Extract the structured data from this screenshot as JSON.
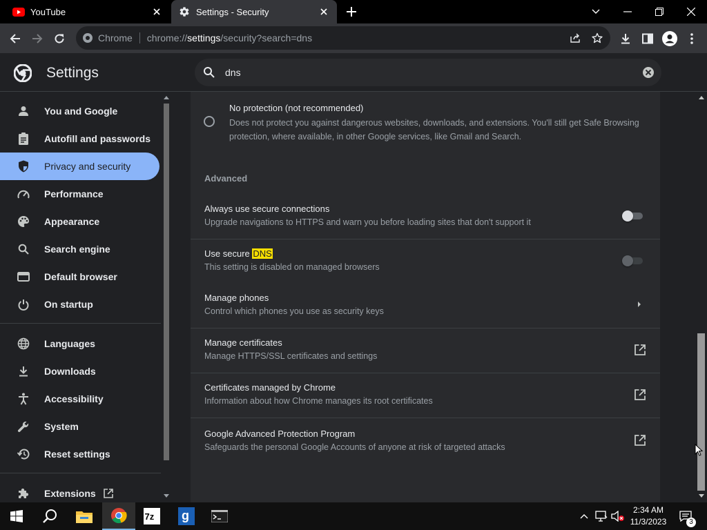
{
  "browser": {
    "tabs": [
      {
        "title": "YouTube",
        "favicon": "youtube-icon",
        "active": false
      },
      {
        "title": "Settings - Security",
        "favicon": "gear-icon",
        "active": true
      }
    ],
    "omnibox": {
      "chip": "Chrome",
      "url_scheme": "chrome://",
      "url_host": "settings",
      "url_rest": "/security?search=dns"
    }
  },
  "settings": {
    "title": "Settings",
    "search_value": "dns",
    "nav": [
      {
        "label": "You and Google",
        "icon": "person-icon"
      },
      {
        "label": "Autofill and passwords",
        "icon": "clipboard-icon"
      },
      {
        "label": "Privacy and security",
        "icon": "shield-icon",
        "selected": true
      },
      {
        "label": "Performance",
        "icon": "speedometer-icon"
      },
      {
        "label": "Appearance",
        "icon": "palette-icon"
      },
      {
        "label": "Search engine",
        "icon": "search-icon"
      },
      {
        "label": "Default browser",
        "icon": "browser-icon"
      },
      {
        "label": "On startup",
        "icon": "power-icon"
      },
      {
        "label": "Languages",
        "icon": "globe-icon"
      },
      {
        "label": "Downloads",
        "icon": "download-icon"
      },
      {
        "label": "Accessibility",
        "icon": "accessibility-icon"
      },
      {
        "label": "System",
        "icon": "wrench-icon"
      },
      {
        "label": "Reset settings",
        "icon": "reset-icon"
      },
      {
        "label": "Extensions",
        "icon": "puzzle-icon"
      }
    ],
    "content": {
      "no_protection": {
        "title": "No protection (not recommended)",
        "desc": "Does not protect you against dangerous websites, downloads, and extensions. You'll still get Safe Browsing protection, where available, in other Google services, like Gmail and Search."
      },
      "advanced_label": "Advanced",
      "rows": [
        {
          "title": "Always use secure connections",
          "desc": "Upgrade navigations to HTTPS and warn you before loading sites that don't support it",
          "control": "toggle",
          "toggle_on": false
        },
        {
          "title_prefix": "Use secure ",
          "title_highlight": "DNS",
          "desc": "This setting is disabled on managed browsers",
          "control": "toggle",
          "disabled": true,
          "toggle_on": false
        },
        {
          "title": "Manage phones",
          "desc": "Control which phones you use as security keys",
          "control": "arrow"
        },
        {
          "title": "Manage certificates",
          "desc": "Manage HTTPS/SSL certificates and settings",
          "control": "external"
        },
        {
          "title": "Certificates managed by Chrome",
          "desc": "Information about how Chrome manages its root certificates",
          "control": "external"
        },
        {
          "title": "Google Advanced Protection Program",
          "desc": "Safeguards the personal Google Accounts of anyone at risk of targeted attacks",
          "control": "external"
        }
      ]
    }
  },
  "taskbar": {
    "apps": [
      "start-icon",
      "search-icon",
      "file-explorer-icon",
      "chrome-icon",
      "7zip-icon",
      "gcompris-icon",
      "terminal-icon"
    ],
    "time": "2:34 AM",
    "date": "11/3/2023",
    "notifications": "3"
  },
  "colors": {
    "accent": "#8ab4f8",
    "highlight": "#f7de00",
    "background": "#202124",
    "card": "#292a2d"
  }
}
